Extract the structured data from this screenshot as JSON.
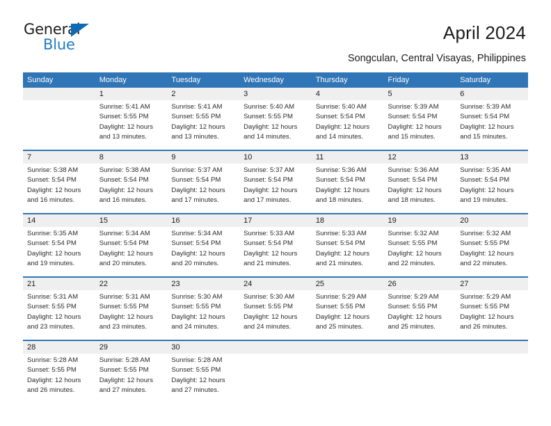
{
  "brand": {
    "name_part1": "General",
    "name_part2": "Blue",
    "triangle_icon": "triangle-icon",
    "accent_color": "#0d6ab3",
    "text_color": "#1d7dc4"
  },
  "header": {
    "title": "April 2024",
    "subtitle": "Songculan, Central Visayas, Philippines",
    "header_bg_color": "#3075b5",
    "daynum_bg_color": "#efefef"
  },
  "weekday_headers": [
    "Sunday",
    "Monday",
    "Tuesday",
    "Wednesday",
    "Thursday",
    "Friday",
    "Saturday"
  ],
  "weeks": [
    [
      {
        "day": "",
        "sunrise": "",
        "sunset": "",
        "daylight1": "",
        "daylight2": ""
      },
      {
        "day": "1",
        "sunrise": "Sunrise: 5:41 AM",
        "sunset": "Sunset: 5:55 PM",
        "daylight1": "Daylight: 12 hours",
        "daylight2": "and 13 minutes."
      },
      {
        "day": "2",
        "sunrise": "Sunrise: 5:41 AM",
        "sunset": "Sunset: 5:55 PM",
        "daylight1": "Daylight: 12 hours",
        "daylight2": "and 13 minutes."
      },
      {
        "day": "3",
        "sunrise": "Sunrise: 5:40 AM",
        "sunset": "Sunset: 5:55 PM",
        "daylight1": "Daylight: 12 hours",
        "daylight2": "and 14 minutes."
      },
      {
        "day": "4",
        "sunrise": "Sunrise: 5:40 AM",
        "sunset": "Sunset: 5:54 PM",
        "daylight1": "Daylight: 12 hours",
        "daylight2": "and 14 minutes."
      },
      {
        "day": "5",
        "sunrise": "Sunrise: 5:39 AM",
        "sunset": "Sunset: 5:54 PM",
        "daylight1": "Daylight: 12 hours",
        "daylight2": "and 15 minutes."
      },
      {
        "day": "6",
        "sunrise": "Sunrise: 5:39 AM",
        "sunset": "Sunset: 5:54 PM",
        "daylight1": "Daylight: 12 hours",
        "daylight2": "and 15 minutes."
      }
    ],
    [
      {
        "day": "7",
        "sunrise": "Sunrise: 5:38 AM",
        "sunset": "Sunset: 5:54 PM",
        "daylight1": "Daylight: 12 hours",
        "daylight2": "and 16 minutes."
      },
      {
        "day": "8",
        "sunrise": "Sunrise: 5:38 AM",
        "sunset": "Sunset: 5:54 PM",
        "daylight1": "Daylight: 12 hours",
        "daylight2": "and 16 minutes."
      },
      {
        "day": "9",
        "sunrise": "Sunrise: 5:37 AM",
        "sunset": "Sunset: 5:54 PM",
        "daylight1": "Daylight: 12 hours",
        "daylight2": "and 17 minutes."
      },
      {
        "day": "10",
        "sunrise": "Sunrise: 5:37 AM",
        "sunset": "Sunset: 5:54 PM",
        "daylight1": "Daylight: 12 hours",
        "daylight2": "and 17 minutes."
      },
      {
        "day": "11",
        "sunrise": "Sunrise: 5:36 AM",
        "sunset": "Sunset: 5:54 PM",
        "daylight1": "Daylight: 12 hours",
        "daylight2": "and 18 minutes."
      },
      {
        "day": "12",
        "sunrise": "Sunrise: 5:36 AM",
        "sunset": "Sunset: 5:54 PM",
        "daylight1": "Daylight: 12 hours",
        "daylight2": "and 18 minutes."
      },
      {
        "day": "13",
        "sunrise": "Sunrise: 5:35 AM",
        "sunset": "Sunset: 5:54 PM",
        "daylight1": "Daylight: 12 hours",
        "daylight2": "and 19 minutes."
      }
    ],
    [
      {
        "day": "14",
        "sunrise": "Sunrise: 5:35 AM",
        "sunset": "Sunset: 5:54 PM",
        "daylight1": "Daylight: 12 hours",
        "daylight2": "and 19 minutes."
      },
      {
        "day": "15",
        "sunrise": "Sunrise: 5:34 AM",
        "sunset": "Sunset: 5:54 PM",
        "daylight1": "Daylight: 12 hours",
        "daylight2": "and 20 minutes."
      },
      {
        "day": "16",
        "sunrise": "Sunrise: 5:34 AM",
        "sunset": "Sunset: 5:54 PM",
        "daylight1": "Daylight: 12 hours",
        "daylight2": "and 20 minutes."
      },
      {
        "day": "17",
        "sunrise": "Sunrise: 5:33 AM",
        "sunset": "Sunset: 5:54 PM",
        "daylight1": "Daylight: 12 hours",
        "daylight2": "and 21 minutes."
      },
      {
        "day": "18",
        "sunrise": "Sunrise: 5:33 AM",
        "sunset": "Sunset: 5:54 PM",
        "daylight1": "Daylight: 12 hours",
        "daylight2": "and 21 minutes."
      },
      {
        "day": "19",
        "sunrise": "Sunrise: 5:32 AM",
        "sunset": "Sunset: 5:55 PM",
        "daylight1": "Daylight: 12 hours",
        "daylight2": "and 22 minutes."
      },
      {
        "day": "20",
        "sunrise": "Sunrise: 5:32 AM",
        "sunset": "Sunset: 5:55 PM",
        "daylight1": "Daylight: 12 hours",
        "daylight2": "and 22 minutes."
      }
    ],
    [
      {
        "day": "21",
        "sunrise": "Sunrise: 5:31 AM",
        "sunset": "Sunset: 5:55 PM",
        "daylight1": "Daylight: 12 hours",
        "daylight2": "and 23 minutes."
      },
      {
        "day": "22",
        "sunrise": "Sunrise: 5:31 AM",
        "sunset": "Sunset: 5:55 PM",
        "daylight1": "Daylight: 12 hours",
        "daylight2": "and 23 minutes."
      },
      {
        "day": "23",
        "sunrise": "Sunrise: 5:30 AM",
        "sunset": "Sunset: 5:55 PM",
        "daylight1": "Daylight: 12 hours",
        "daylight2": "and 24 minutes."
      },
      {
        "day": "24",
        "sunrise": "Sunrise: 5:30 AM",
        "sunset": "Sunset: 5:55 PM",
        "daylight1": "Daylight: 12 hours",
        "daylight2": "and 24 minutes."
      },
      {
        "day": "25",
        "sunrise": "Sunrise: 5:29 AM",
        "sunset": "Sunset: 5:55 PM",
        "daylight1": "Daylight: 12 hours",
        "daylight2": "and 25 minutes."
      },
      {
        "day": "26",
        "sunrise": "Sunrise: 5:29 AM",
        "sunset": "Sunset: 5:55 PM",
        "daylight1": "Daylight: 12 hours",
        "daylight2": "and 25 minutes."
      },
      {
        "day": "27",
        "sunrise": "Sunrise: 5:29 AM",
        "sunset": "Sunset: 5:55 PM",
        "daylight1": "Daylight: 12 hours",
        "daylight2": "and 26 minutes."
      }
    ],
    [
      {
        "day": "28",
        "sunrise": "Sunrise: 5:28 AM",
        "sunset": "Sunset: 5:55 PM",
        "daylight1": "Daylight: 12 hours",
        "daylight2": "and 26 minutes."
      },
      {
        "day": "29",
        "sunrise": "Sunrise: 5:28 AM",
        "sunset": "Sunset: 5:55 PM",
        "daylight1": "Daylight: 12 hours",
        "daylight2": "and 27 minutes."
      },
      {
        "day": "30",
        "sunrise": "Sunrise: 5:28 AM",
        "sunset": "Sunset: 5:55 PM",
        "daylight1": "Daylight: 12 hours",
        "daylight2": "and 27 minutes."
      },
      {
        "day": "",
        "sunrise": "",
        "sunset": "",
        "daylight1": "",
        "daylight2": ""
      },
      {
        "day": "",
        "sunrise": "",
        "sunset": "",
        "daylight1": "",
        "daylight2": ""
      },
      {
        "day": "",
        "sunrise": "",
        "sunset": "",
        "daylight1": "",
        "daylight2": ""
      },
      {
        "day": "",
        "sunrise": "",
        "sunset": "",
        "daylight1": "",
        "daylight2": ""
      }
    ]
  ]
}
